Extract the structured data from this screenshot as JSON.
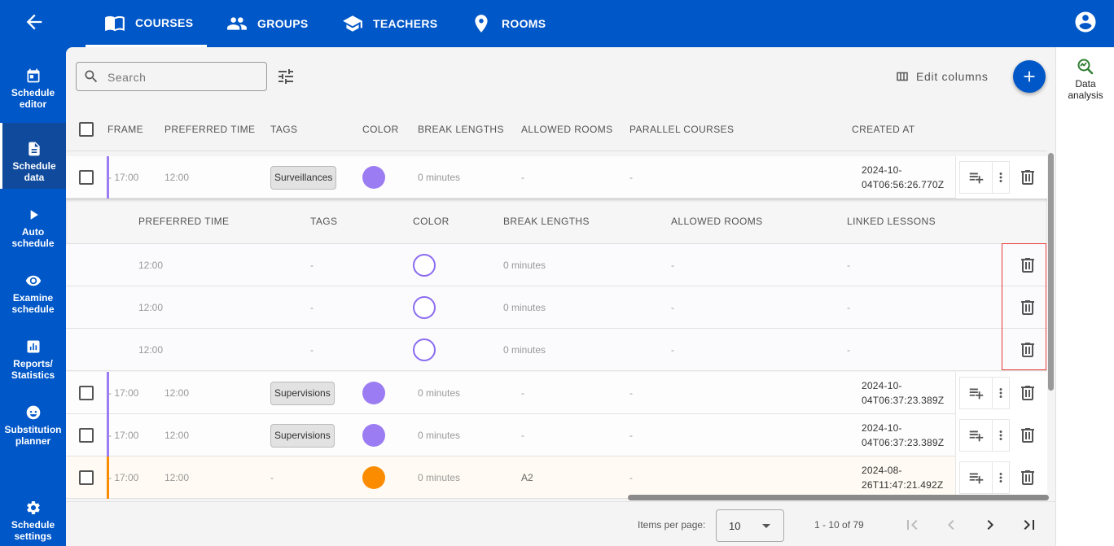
{
  "nav": {
    "tabs": [
      {
        "label": "COURSES",
        "icon": "book-icon"
      },
      {
        "label": "GROUPS",
        "icon": "group-icon"
      },
      {
        "label": "TEACHERS",
        "icon": "school-icon"
      },
      {
        "label": "ROOMS",
        "icon": "location-pin-icon"
      }
    ],
    "active_tab": "COURSES"
  },
  "sidebar": {
    "items": [
      {
        "label": "Schedule editor",
        "icon": "calendar-icon"
      },
      {
        "label": "Schedule data",
        "icon": "document-icon"
      },
      {
        "label": "Auto schedule",
        "icon": "play-icon"
      },
      {
        "label": "Examine schedule",
        "icon": "eye-icon"
      },
      {
        "label": "Reports/ Statistics",
        "icon": "bar-chart-icon"
      },
      {
        "label": "Substitution planner",
        "icon": "face-icon"
      },
      {
        "label": "Schedule settings",
        "icon": "gear-icon"
      }
    ],
    "active": "Schedule data"
  },
  "toolbar": {
    "search_placeholder": "Search",
    "edit_columns_label": "Edit columns"
  },
  "right_panel": {
    "data_analysis_label": "Data analysis"
  },
  "table": {
    "headers": [
      "FRAME",
      "PREFERRED TIME",
      "TAGS",
      "COLOR",
      "BREAK LENGTHS",
      "ALLOWED ROOMS",
      "PARALLEL COURSES",
      "CREATED AT"
    ],
    "rows": [
      {
        "frame": "- 17:00",
        "preferred_time": "12:00",
        "tag": "Surveillances",
        "color": "#9c7cf2",
        "break_lengths": "0 minutes",
        "allowed_rooms": "-",
        "parallel_courses": "-",
        "created_at_line1": "2024-10-",
        "created_at_line2": "04T06:56:26.770Z",
        "bar_color": "#9c7cf2"
      },
      {
        "frame": "- 17:00",
        "preferred_time": "12:00",
        "tag": "Supervisions",
        "color": "#9c7cf2",
        "break_lengths": "0 minutes",
        "allowed_rooms": "-",
        "parallel_courses": "-",
        "created_at_line1": "2024-10-",
        "created_at_line2": "04T06:37:23.389Z",
        "bar_color": "#9c7cf2"
      },
      {
        "frame": "- 17:00",
        "preferred_time": "12:00",
        "tag": "Supervisions",
        "color": "#9c7cf2",
        "break_lengths": "0 minutes",
        "allowed_rooms": "-",
        "parallel_courses": "-",
        "created_at_line1": "2024-10-",
        "created_at_line2": "04T06:37:23.389Z",
        "bar_color": "#9c7cf2"
      },
      {
        "frame": "- 17:00",
        "preferred_time": "12:00",
        "tag": "-",
        "color": "#fb8c00",
        "break_lengths": "0 minutes",
        "allowed_rooms": "A2",
        "parallel_courses": "-",
        "created_at_line1": "2024-08-",
        "created_at_line2": "26T11:47:21.492Z",
        "bar_color": "#fb8c00"
      }
    ]
  },
  "subtable": {
    "headers": [
      "PREFERRED TIME",
      "TAGS",
      "COLOR",
      "BREAK LENGTHS",
      "ALLOWED ROOMS",
      "LINKED LESSONS"
    ],
    "rows": [
      {
        "preferred_time": "12:00",
        "tags": "-",
        "break_lengths": "0 minutes",
        "allowed_rooms": "-",
        "linked_lessons": "-"
      },
      {
        "preferred_time": "12:00",
        "tags": "-",
        "break_lengths": "0 minutes",
        "allowed_rooms": "-",
        "linked_lessons": "-"
      },
      {
        "preferred_time": "12:00",
        "tags": "-",
        "break_lengths": "0 minutes",
        "allowed_rooms": "-",
        "linked_lessons": "-"
      }
    ]
  },
  "pagination": {
    "items_per_page_label": "Items per page:",
    "items_per_page": "10",
    "range": "1 - 10 of 79"
  }
}
